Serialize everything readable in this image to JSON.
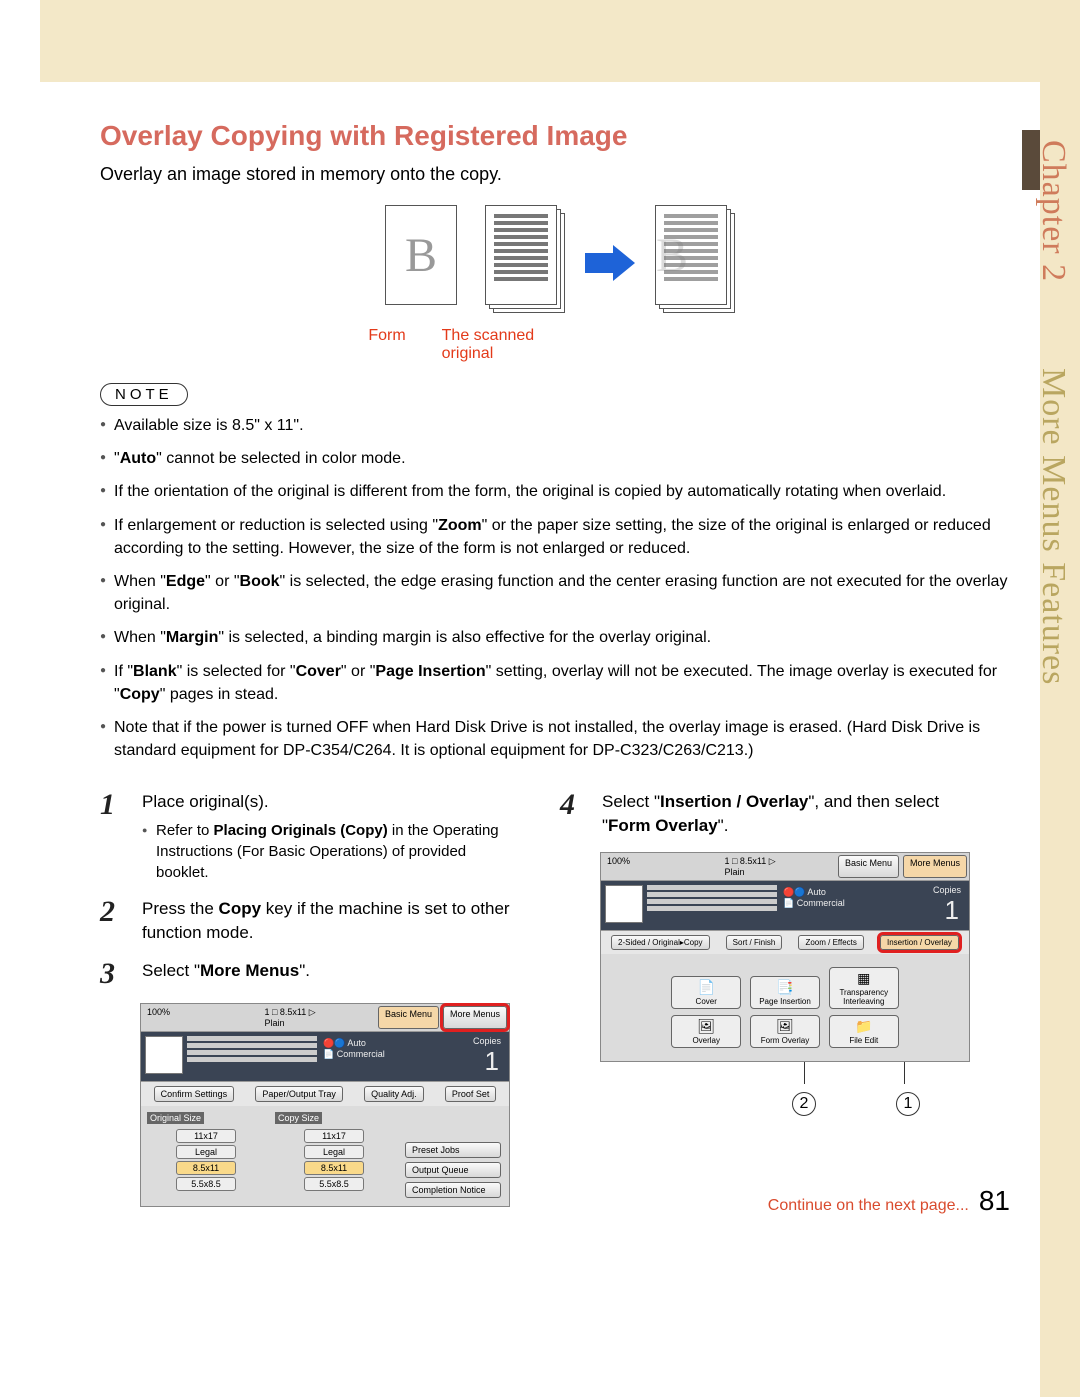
{
  "sidebar": {
    "chapter": "Chapter 2",
    "section": "More Menus Features"
  },
  "title": "Overlay Copying with Registered Image",
  "intro": "Overlay an image stored in memory onto the copy.",
  "diagram": {
    "form_label": "Form",
    "scanned_label": "The scanned original",
    "letter": "B"
  },
  "note_label": "NOTE",
  "notes": [
    {
      "text": "Available size is 8.5\" x 11\"."
    },
    {
      "pre": "\"",
      "bold": "Auto",
      "post": "\" cannot be selected in color mode."
    },
    {
      "text": "If the orientation of the original is different from the form, the original is copied by automatically rotating when overlaid."
    },
    {
      "pre": "If enlargement or reduction is selected using \"",
      "bold": "Zoom",
      "post": "\" or the paper size setting, the size of the original is enlarged or reduced according to the setting. However, the size of the form is not enlarged or reduced."
    },
    {
      "pre": "When \"",
      "bold": "Edge",
      "mid1": "\" or \"",
      "bold2": "Book",
      "post": "\" is selected, the edge erasing function and the center erasing function are not executed for the overlay original."
    },
    {
      "pre": "When \"",
      "bold": "Margin",
      "post": "\" is selected, a binding margin is also effective for the overlay original."
    },
    {
      "pre": "If \"",
      "bold": "Blank",
      "mid1": "\" is selected for \"",
      "bold2": "Cover",
      "mid2": "\" or \"",
      "bold3": "Page Insertion",
      "mid3": "\" setting, overlay will not be executed. The image overlay is executed for \"",
      "bold4": "Copy",
      "post": "\" pages in stead."
    },
    {
      "text": "Note that if the power is turned OFF when Hard Disk Drive is not installed, the overlay image is erased. (Hard Disk Drive is standard equipment for DP-C354/C264. It is optional equipment for DP-C323/C263/C213.)"
    }
  ],
  "steps": {
    "s1": {
      "num": "1",
      "text": "Place original(s).",
      "sub_pre": "Refer to ",
      "sub_bold": "Placing Originals (Copy)",
      "sub_post": " in the Operating Instructions (For Basic Operations) of provided booklet."
    },
    "s2": {
      "num": "2",
      "pre": "Press the ",
      "bold": "Copy",
      "post": " key if the machine is set to other function mode."
    },
    "s3": {
      "num": "3",
      "pre": "Select \"",
      "bold": "More Menus",
      "post": "\"."
    },
    "s4": {
      "num": "4",
      "pre": "Select \"",
      "bold": "Insertion / Overlay",
      "mid": "\", and then select \"",
      "bold2": "Form Overlay",
      "post": "\"."
    }
  },
  "screen1": {
    "zoom": "100%",
    "paper": "1 □ 8.5x11 ▷",
    "plain": "Plain",
    "basic_menu": "Basic Menu",
    "more_menus": "More Menus",
    "auto": "Auto",
    "commercial": "Commercial",
    "copies": "Copies",
    "count": "1",
    "confirm": "Confirm Settings",
    "paper_tray": "Paper/Output Tray",
    "quality": "Quality Adj.",
    "proof": "Proof Set",
    "orig_size": "Original Size",
    "copy_size": "Copy Size",
    "s1": "11x17",
    "s2": "11x17",
    "s3": "Legal",
    "s4": "Legal",
    "s5": "8.5x11",
    "s6": "8.5x11",
    "s7": "5.5x8.5",
    "s8": "5.5x8.5",
    "preset": "Preset Jobs",
    "queue": "Output Queue",
    "completion": "Completion Notice"
  },
  "screen2": {
    "zoom": "100%",
    "paper": "1 □ 8.5x11 ▷",
    "plain": "Plain",
    "basic_menu": "Basic Menu",
    "more_menus": "More Menus",
    "auto": "Auto",
    "commercial": "Commercial",
    "copies": "Copies",
    "count": "1",
    "tab1": "2-Sided / Original▸Copy",
    "tab2": "Sort / Finish",
    "tab3": "Zoom / Effects",
    "tab4": "Insertion / Overlay",
    "b1": "Cover",
    "b2": "Page Insertion",
    "b3": "Transparency Interleaving",
    "b4": "Overlay",
    "b5": "Form Overlay",
    "b6": "File Edit"
  },
  "callouts": {
    "c1": "1",
    "c2": "2"
  },
  "footer": {
    "continue": "Continue on the next page...",
    "page": "81"
  }
}
